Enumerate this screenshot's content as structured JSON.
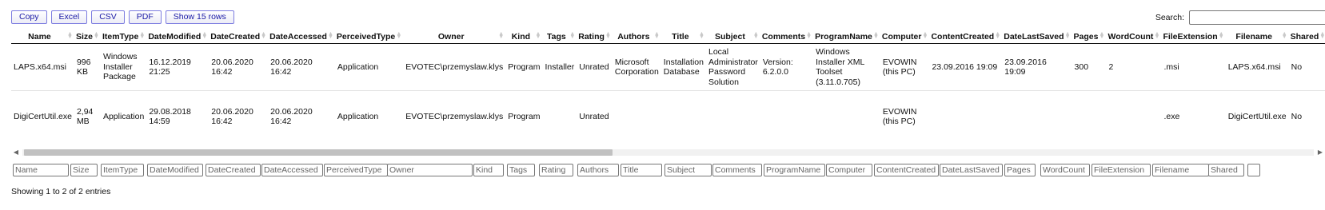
{
  "buttons": {
    "copy": "Copy",
    "excel": "Excel",
    "csv": "CSV",
    "pdf": "PDF",
    "show_rows": "Show 15 rows"
  },
  "search": {
    "label": "Search:"
  },
  "columns": [
    "Name",
    "Size",
    "ItemType",
    "DateModified",
    "DateCreated",
    "DateAccessed",
    "PerceivedType",
    "Owner",
    "Kind",
    "Tags",
    "Rating",
    "Authors",
    "Title",
    "Subject",
    "Comments",
    "ProgramName",
    "Computer",
    "ContentCreated",
    "DateLastSaved",
    "Pages",
    "WordCount",
    "FileExtension",
    "Filename",
    "Shared"
  ],
  "rows": [
    [
      "LAPS.x64.msi",
      "996 KB",
      "Windows Installer Package",
      "16.12.2019 21:25",
      "20.06.2020 16:42",
      "20.06.2020 16:42",
      "Application",
      "EVOTEC\\przemyslaw.klys",
      "Program",
      "Installer",
      "Unrated",
      "Microsoft Corporation",
      "Installation Database",
      "Local Administrator Password Solution",
      "Version: 6.2.0.0",
      "Windows Installer XML Toolset (3.11.0.705)",
      "EVOWIN (this PC)",
      "23.09.2016 19:09",
      "23.09.2016 19:09",
      "300",
      "2",
      ".msi",
      "LAPS.x64.msi",
      "No"
    ],
    [
      "DigiCertUtil.exe",
      "2,94 MB",
      "Application",
      "29.08.2018 14:59",
      "20.06.2020 16:42",
      "20.06.2020 16:42",
      "Application",
      "EVOTEC\\przemyslaw.klys",
      "Program",
      "",
      "Unrated",
      "",
      "",
      "",
      "",
      "",
      "EVOWIN (this PC)",
      "",
      "",
      "",
      "",
      ".exe",
      "DigiCertUtil.exe",
      "No"
    ]
  ],
  "footer": {
    "info": "Showing 1 to 2 of 2 entries"
  }
}
